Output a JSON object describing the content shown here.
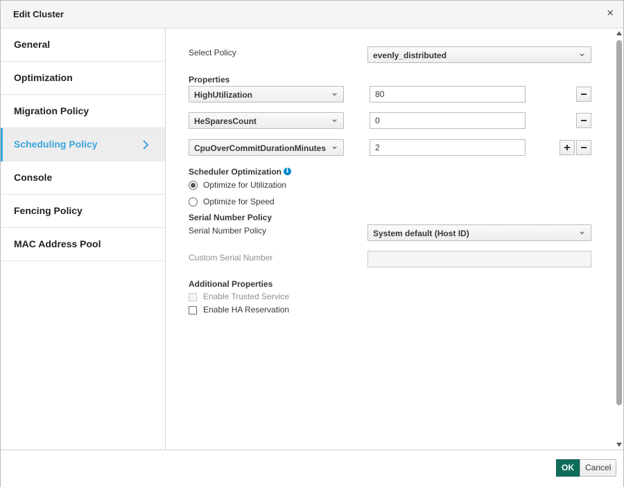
{
  "dialog": {
    "title": "Edit Cluster",
    "close_symbol": "×"
  },
  "sidebar": {
    "items": [
      {
        "label": "General",
        "active": false
      },
      {
        "label": "Optimization",
        "active": false
      },
      {
        "label": "Migration Policy",
        "active": false
      },
      {
        "label": "Scheduling Policy",
        "active": true
      },
      {
        "label": "Console",
        "active": false
      },
      {
        "label": "Fencing Policy",
        "active": false
      },
      {
        "label": "MAC Address Pool",
        "active": false
      }
    ]
  },
  "scheduling": {
    "select_policy_label": "Select Policy",
    "select_policy_value": "evenly_distributed",
    "properties_heading": "Properties",
    "properties": [
      {
        "key": "HighUtilization",
        "value": "80"
      },
      {
        "key": "HeSparesCount",
        "value": "0"
      },
      {
        "key": "CpuOverCommitDurationMinutes",
        "value": "2"
      }
    ],
    "scheduler_optimization_heading": "Scheduler Optimization",
    "optimize_utilization_label": "Optimize for Utilization",
    "optimize_speed_label": "Optimize for Speed",
    "optimization_selected": "Optimize for Utilization",
    "serial_heading": "Serial Number Policy",
    "serial_policy_label": "Serial Number Policy",
    "serial_policy_value": "System default (Host ID)",
    "custom_serial_label": "Custom Serial Number",
    "custom_serial_value": "",
    "additional_heading": "Additional Properties",
    "enable_trusted_label": "Enable Trusted Service",
    "enable_ha_label": "Enable HA Reservation",
    "enable_trusted_checked": false,
    "enable_ha_checked": false
  },
  "footer": {
    "ok_label": "OK",
    "cancel_label": "Cancel"
  },
  "icons": {
    "active_chevron": "chevron-right-icon",
    "info": "info-icon"
  },
  "colors": {
    "accent": "#39a5dc",
    "primary_button": "#0e6e5c",
    "info": "#0088ce"
  }
}
